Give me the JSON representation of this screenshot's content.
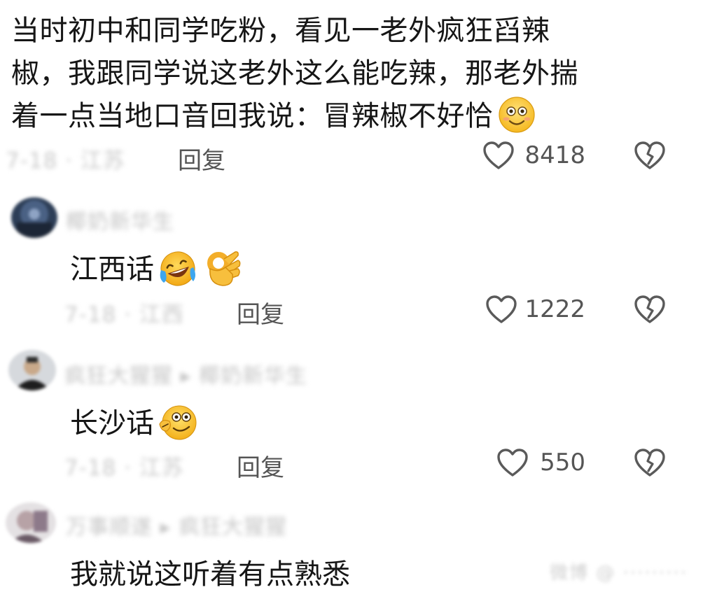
{
  "main_comment": {
    "lines": [
      "当时初中和同学吃粉，看见一老外疯狂舀辣",
      "椒，我跟同学说这老外这么能吃辣，那老外揣",
      "着一点当地口音回我说：冒辣椒不好恰"
    ],
    "emoji": "smiling-face",
    "meta": "7-18 · 江苏",
    "reply_label": "回复",
    "like_count": "8418"
  },
  "replies": [
    {
      "username": "椰奶新华生",
      "text": "江西话",
      "emojis": [
        "laughing-crying-face",
        "ok-hand"
      ],
      "meta": "7-18 · 江西",
      "reply_label": "回复",
      "like_count": "1222"
    },
    {
      "username": "疯狂大猩猩 ▸ 椰奶新华生",
      "text": "长沙话",
      "emojis": [
        "playful-face"
      ],
      "meta": "7-18 · 江苏",
      "reply_label": "回复",
      "like_count": "550"
    },
    {
      "username": "万事顺遂 ▸ 疯狂大猩猩",
      "text": "我就说这听着有点熟悉",
      "emojis": []
    }
  ],
  "watermark": "微博 @ ·········",
  "colors": {
    "text": "#161616",
    "meta": "#555555",
    "icon_stroke": "#5a5a5a",
    "blur_text": "#c9c9c9"
  }
}
